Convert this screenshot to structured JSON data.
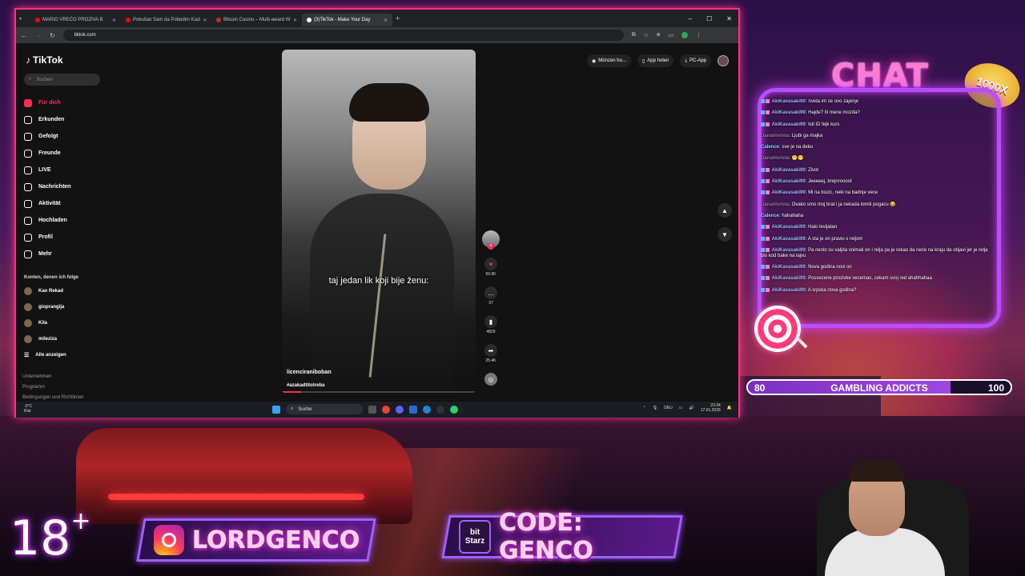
{
  "browser": {
    "tabs": [
      {
        "title": "MARIO VREĆO PROZIVA B",
        "color": "#ff0000",
        "active": false
      },
      {
        "title": "Pokušao Sam da Pobedim Kazi",
        "color": "#ff0000",
        "active": false
      },
      {
        "title": "Bitcoin Casino – Multi-award W",
        "color": "#c82a3a",
        "active": false
      },
      {
        "title": "(3)TikTok - Make Your Day",
        "color": "#ffffff",
        "active": true
      }
    ],
    "new_tab": "+",
    "url": "tiktok.com",
    "window_controls": [
      "–",
      "☐",
      "✕"
    ]
  },
  "tiktok": {
    "logo": "TikTok",
    "search_placeholder": "Suchen",
    "nav": [
      {
        "label": "Für dich",
        "active": true
      },
      {
        "label": "Erkunden",
        "active": false
      },
      {
        "label": "Gefolgt",
        "active": false
      },
      {
        "label": "Freunde",
        "active": false
      },
      {
        "label": "LIVE",
        "active": false
      },
      {
        "label": "Nachrichten",
        "active": false
      },
      {
        "label": "Aktivität",
        "active": false
      },
      {
        "label": "Hochladen",
        "active": false
      },
      {
        "label": "Profil",
        "active": false
      },
      {
        "label": "Mehr",
        "active": false
      }
    ],
    "following_header": "Konten, denen ich folge",
    "following": [
      "Kao Rekad",
      "gioprangija",
      "Kila",
      "mileziza"
    ],
    "show_all": "Alle anzeigen",
    "footer": [
      "Unternehmen",
      "Programm",
      "Bedingungen und Richtlinien"
    ],
    "top_actions": [
      "Münzen ho...",
      "App holen",
      "PC-App"
    ],
    "video": {
      "caption": "taj jedan lik koji bije ženu:",
      "username": "licenciraniboban",
      "hashtag": "#azakadtitotreba",
      "likes": "59.9K",
      "comments": "37",
      "saves": "4829",
      "shares": "25.4K",
      "progress": 0.1
    }
  },
  "taskbar": {
    "weather_temp": "-3°C",
    "weather_desc": "Klar",
    "search": "Suche",
    "lang": "DEU",
    "time": "23:34",
    "date": "17.01.2026"
  },
  "overlay": {
    "chat_title": "CHAT",
    "badge": "1000X",
    "messages": [
      {
        "user": "AkiKavasaki99",
        "text": "Svida im se ovo zajenje",
        "style": "badge"
      },
      {
        "user": "AkiKavasaki99",
        "text": "Hajde? Ili mene mozda?",
        "style": "badge"
      },
      {
        "user": "AkiKavasaki99",
        "text": "Isti ID fejk kurs",
        "style": "badge"
      },
      {
        "user": "Danalmvista",
        "text": "Ljubi ga majka",
        "style": "gray"
      },
      {
        "user": "Calence",
        "text": "sve je na deku",
        "style": "teal"
      },
      {
        "user": "Danalmvista",
        "text": "😁😁",
        "style": "gray"
      },
      {
        "user": "AkiKavasaki99",
        "text": "Zivot",
        "style": "badge"
      },
      {
        "user": "AkiKavasaki99",
        "text": "Jeeeeej, brejnroooot",
        "style": "badge"
      },
      {
        "user": "AkiKavasaki99",
        "text": "Mi na bozic, neki na badnje vece",
        "style": "badge"
      },
      {
        "user": "Danalmvista",
        "text": "Ovako smo moj brat i ja nekada lomili pogacu 😂",
        "style": "gray"
      },
      {
        "user": "Calence",
        "text": "hahahaha",
        "style": "teal"
      },
      {
        "user": "AkiKavasaki99",
        "text": "Halo levijatan",
        "style": "badge"
      },
      {
        "user": "AkiKavasaki99",
        "text": "A sta je on pravio s reljom",
        "style": "badge"
      },
      {
        "user": "AkiKavasaki99",
        "text": "Pa nesto su valjda snimali on i relja pa je rekao da neće na kraju da objavi jer je relja bio kod bake na lajvu",
        "style": "badge"
      },
      {
        "user": "AkiKavasaki99",
        "text": "Nova godina novi on",
        "style": "badge"
      },
      {
        "user": "AkiKavasaki99",
        "text": "Posvecene prozivke vecemas, cekam svoj red ahahhahaa",
        "style": "badge"
      },
      {
        "user": "AkiKavasaki99",
        "text": "A srpska nova godina?",
        "style": "badge"
      }
    ],
    "goal": {
      "start": "80",
      "label": "GAMBLING ADDICTS",
      "end": "100",
      "progress": 0.77
    },
    "age": "18",
    "age_plus": "+",
    "instagram": "LORDGENCO",
    "bitstarz_logo": "bit Starz",
    "code": "CODE: GENCO"
  }
}
